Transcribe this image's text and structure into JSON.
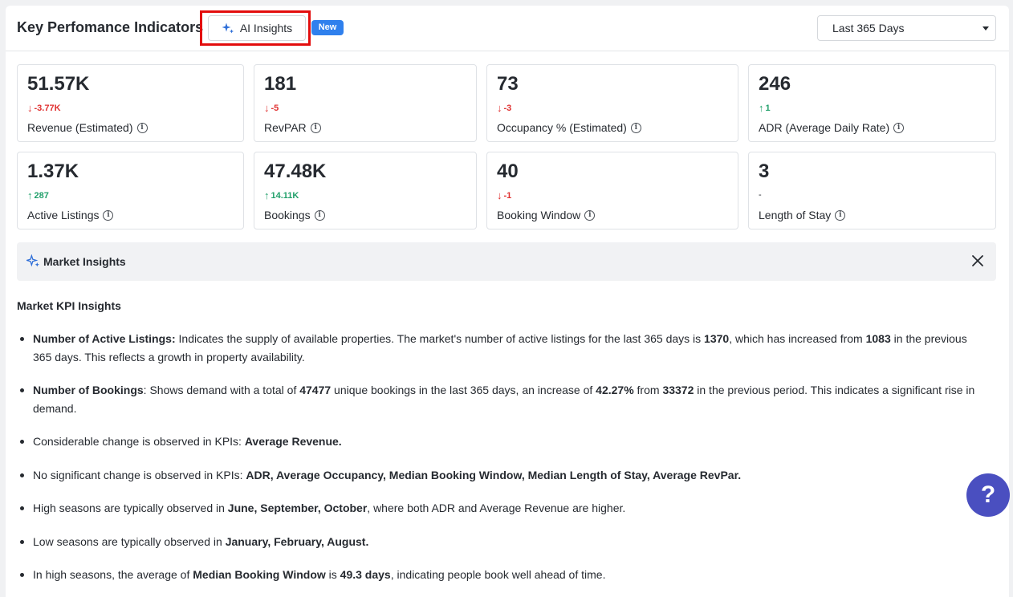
{
  "header": {
    "title": "Key Perfomance Indicators",
    "ai_button_label": "AI Insights",
    "new_badge": "New",
    "period_select": "Last 365 Days"
  },
  "kpis": [
    {
      "value": "51.57K",
      "delta": "-3.77K",
      "direction": "down",
      "label": "Revenue (Estimated)"
    },
    {
      "value": "181",
      "delta": "-5",
      "direction": "down",
      "label": "RevPAR"
    },
    {
      "value": "73",
      "delta": "-3",
      "direction": "down",
      "label": "Occupancy % (Estimated)"
    },
    {
      "value": "246",
      "delta": "1",
      "direction": "up",
      "label": "ADR (Average Daily Rate)"
    },
    {
      "value": "1.37K",
      "delta": "287",
      "direction": "up",
      "label": "Active Listings"
    },
    {
      "value": "47.48K",
      "delta": "14.11K",
      "direction": "up",
      "label": "Bookings"
    },
    {
      "value": "40",
      "delta": "-1",
      "direction": "down",
      "label": "Booking Window"
    },
    {
      "value": "3",
      "delta": "-",
      "direction": "flat",
      "label": "Length of Stay"
    }
  ],
  "insights": {
    "panel_title": "Market Insights",
    "heading": "Market KPI Insights",
    "bullets": [
      [
        {
          "t": "Number of Active Listings:",
          "b": true
        },
        {
          "t": " Indicates the supply of available properties. The market's number of active listings for the last 365 days is "
        },
        {
          "t": "1370",
          "b": true
        },
        {
          "t": ", which has increased from "
        },
        {
          "t": "1083",
          "b": true
        },
        {
          "t": " in the previous 365 days. This reflects a growth in property availability."
        }
      ],
      [
        {
          "t": "Number of Bookings",
          "b": true
        },
        {
          "t": ": Shows demand with a total of "
        },
        {
          "t": "47477",
          "b": true
        },
        {
          "t": " unique bookings in the last 365 days, an increase of "
        },
        {
          "t": "42.27%",
          "b": true
        },
        {
          "t": " from "
        },
        {
          "t": "33372",
          "b": true
        },
        {
          "t": " in the previous period. This indicates a significant rise in demand."
        }
      ],
      [
        {
          "t": "Considerable change is observed in KPIs: "
        },
        {
          "t": "Average Revenue.",
          "b": true
        }
      ],
      [
        {
          "t": "No significant change is observed in KPIs: "
        },
        {
          "t": "ADR, Average Occupancy, Median Booking Window, Median Length of Stay, Average RevPar.",
          "b": true
        }
      ],
      [
        {
          "t": "High seasons are typically observed in "
        },
        {
          "t": "June, September, October",
          "b": true
        },
        {
          "t": ", where both ADR and Average Revenue are higher."
        }
      ],
      [
        {
          "t": "Low seasons are typically observed in "
        },
        {
          "t": "January, February, August.",
          "b": true
        }
      ],
      [
        {
          "t": "In high seasons, the average of "
        },
        {
          "t": "Median Booking Window",
          "b": true
        },
        {
          "t": " is "
        },
        {
          "t": "49.3 days",
          "b": true
        },
        {
          "t": ", indicating people book well ahead of time."
        }
      ]
    ]
  },
  "help_button": "?",
  "colors": {
    "accent": "#2f80ed",
    "highlight": "#e30d0d",
    "down": "#e03131",
    "up": "#22a06b",
    "help": "#4a4fc0"
  }
}
